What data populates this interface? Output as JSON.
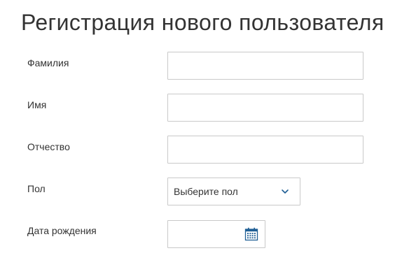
{
  "page": {
    "title": "Регистрация нового пользователя"
  },
  "form": {
    "last_name": {
      "label": "Фамилия",
      "value": ""
    },
    "first_name": {
      "label": "Имя",
      "value": ""
    },
    "middle_name": {
      "label": "Отчество",
      "value": ""
    },
    "gender": {
      "label": "Пол",
      "selected": "Выберите пол"
    },
    "birth_date": {
      "label": "Дата рождения",
      "value": "",
      "icon": "calendar-icon"
    }
  },
  "colors": {
    "border": "#c9c9c9",
    "text": "#333333",
    "accent": "#1f5f95"
  }
}
